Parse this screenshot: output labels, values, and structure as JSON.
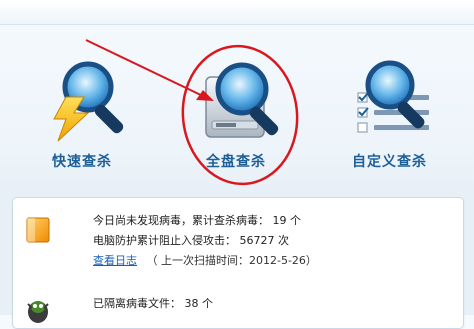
{
  "scan": {
    "quick_label": "快速查杀",
    "full_label": "全盘查杀",
    "custom_label": "自定义查杀"
  },
  "status": {
    "line1_prefix": "今日尚未发现病毒，累计查杀病毒：",
    "line1_count": "19",
    "line1_unit": "个",
    "line2_prefix": "电脑防护累计阻止入侵攻击：",
    "line2_count": "56727",
    "line2_unit": "次",
    "view_log": "查看日志",
    "last_scan": "（ 上一次扫描时间：2012-5-26）",
    "quarantine_prefix": "已隔离病毒文件：",
    "quarantine_count": "38",
    "quarantine_unit": "个"
  },
  "colors": {
    "accent_red": "#d8181e",
    "label_blue": "#1e5f98",
    "link_blue": "#1a5fb4"
  }
}
